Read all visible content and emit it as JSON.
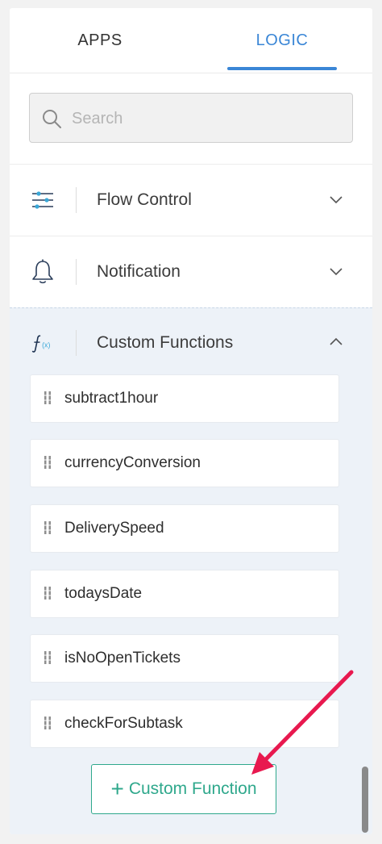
{
  "tabs": [
    {
      "label": "APPS",
      "active": false
    },
    {
      "label": "LOGIC",
      "active": true
    }
  ],
  "search": {
    "placeholder": "Search",
    "value": ""
  },
  "sections": [
    {
      "label": "Flow Control",
      "icon": "sliders-icon",
      "expanded": false
    },
    {
      "label": "Notification",
      "icon": "bell-icon",
      "expanded": false
    },
    {
      "label": "Custom Functions",
      "icon": "function-icon",
      "expanded": true
    }
  ],
  "functions": [
    {
      "label": "subtract1hour"
    },
    {
      "label": "currencyConversion"
    },
    {
      "label": "DeliverySpeed"
    },
    {
      "label": "todaysDate"
    },
    {
      "label": "isNoOpenTickets"
    },
    {
      "label": "checkForSubtask"
    }
  ],
  "add_button": {
    "plus": "+",
    "label": "Custom Function"
  },
  "colors": {
    "accent_blue": "#3a86d6",
    "accent_green": "#2fa88c",
    "annotation_arrow": "#e8194f"
  }
}
